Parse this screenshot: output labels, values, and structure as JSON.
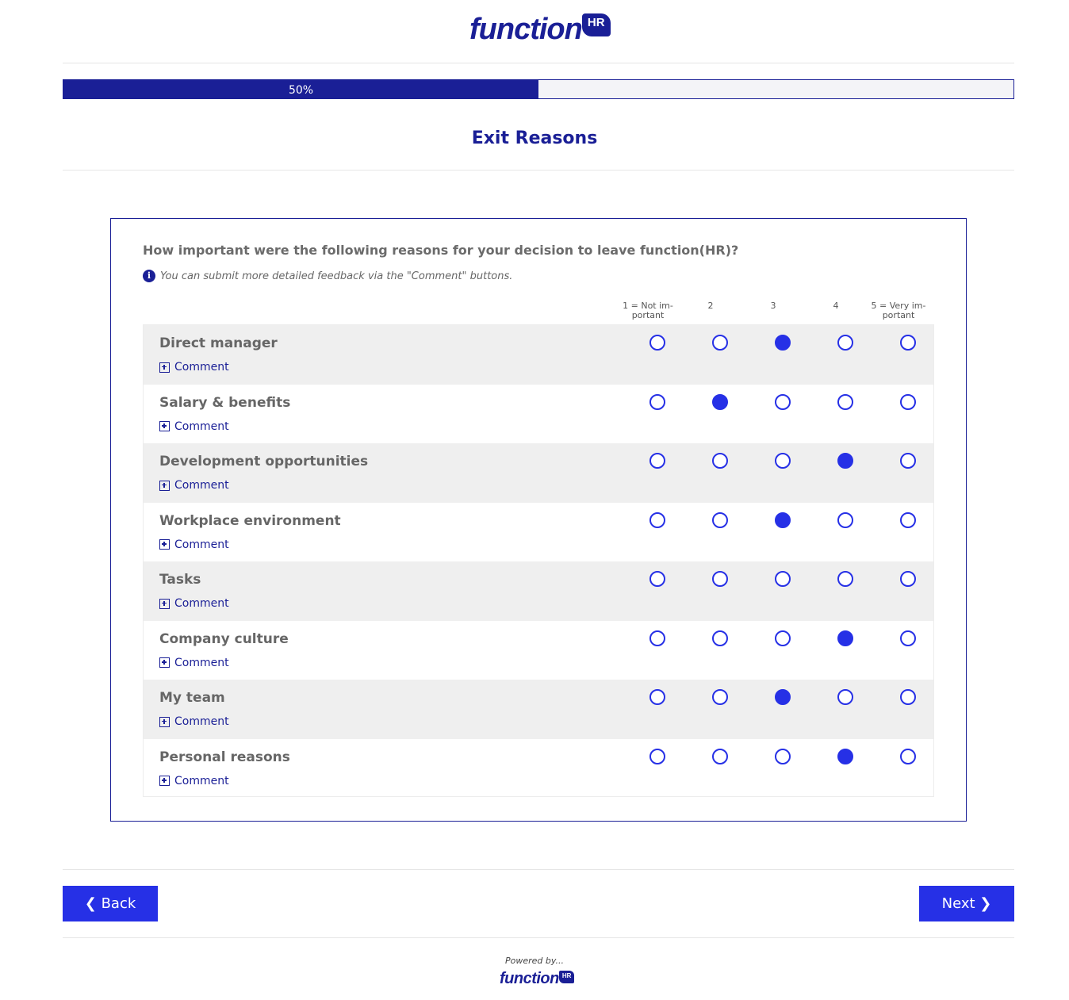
{
  "brand": {
    "name": "function",
    "badge": "HR",
    "color": "#1a1f96",
    "accent": "#2630e6"
  },
  "progress": {
    "percent": 50,
    "label": "50%"
  },
  "page_title": "Exit Reasons",
  "question": "How important were the following reasons for your decision to leave function(HR)?",
  "info_icon": "info-icon",
  "info_text": "You can submit more detailed feedback via the \"Comment\" buttons.",
  "columns": [
    "1 = Not im-\nportant",
    "2",
    "3",
    "4",
    "5 = Very im-\nportant"
  ],
  "comment_label": "Comment",
  "rows": [
    {
      "label": "Direct manager",
      "selected": 3
    },
    {
      "label": "Salary & benefits",
      "selected": 2
    },
    {
      "label": "Development opportunities",
      "selected": 4
    },
    {
      "label": "Workplace environment",
      "selected": 3
    },
    {
      "label": "Tasks",
      "selected": null
    },
    {
      "label": "Company culture",
      "selected": 4
    },
    {
      "label": "My team",
      "selected": 3
    },
    {
      "label": "Personal reasons",
      "selected": 4
    }
  ],
  "nav": {
    "back_label": "Back",
    "next_label": "Next"
  },
  "footer": {
    "powered_by": "Powered by..."
  }
}
